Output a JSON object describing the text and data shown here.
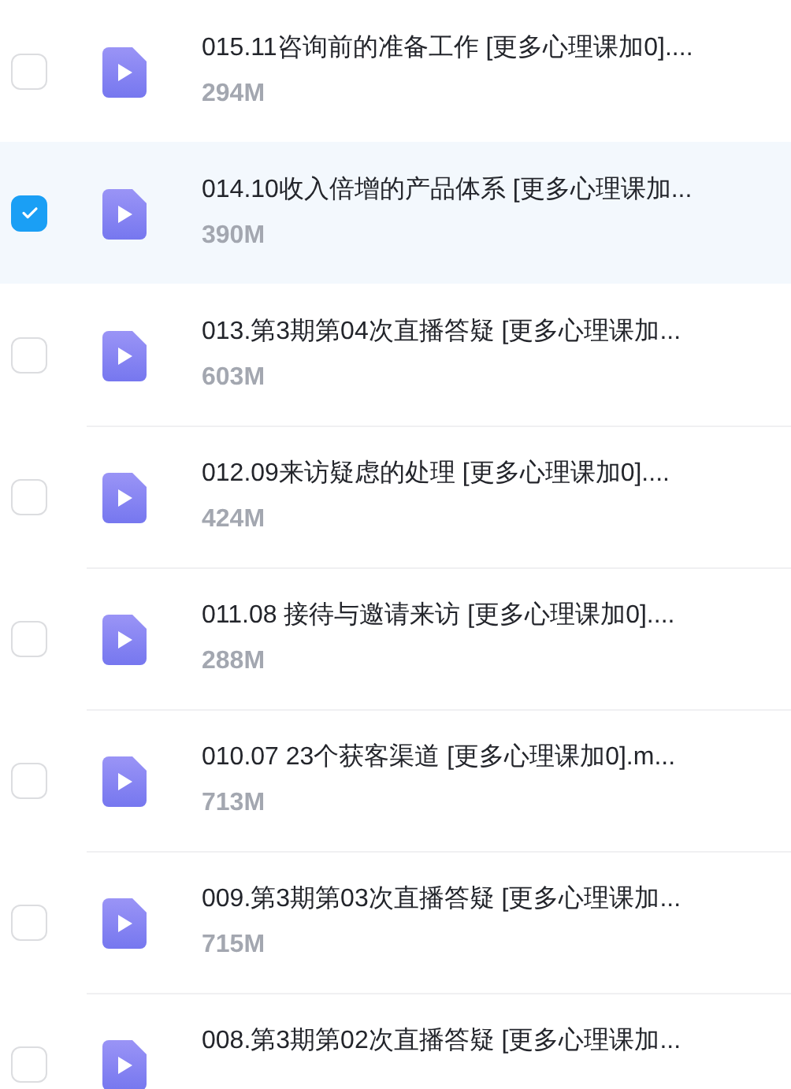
{
  "files": [
    {
      "name": "015.11咨询前的准备工作 [更多心理课加0]....",
      "size": "294M",
      "selected": false
    },
    {
      "name": "014.10收入倍增的产品体系 [更多心理课加...",
      "size": "390M",
      "selected": true
    },
    {
      "name": "013.第3期第04次直播答疑 [更多心理课加...",
      "size": "603M",
      "selected": false
    },
    {
      "name": "012.09来访疑虑的处理 [更多心理课加0]....",
      "size": "424M",
      "selected": false
    },
    {
      "name": "011.08 接待与邀请来访 [更多心理课加0]....",
      "size": "288M",
      "selected": false
    },
    {
      "name": "010.07 23个获客渠道 [更多心理课加0].m...",
      "size": "713M",
      "selected": false
    },
    {
      "name": "009.第3期第03次直播答疑 [更多心理课加...",
      "size": "715M",
      "selected": false
    },
    {
      "name": "008.第3期第02次直播答疑 [更多心理课加...",
      "selected": false
    }
  ]
}
